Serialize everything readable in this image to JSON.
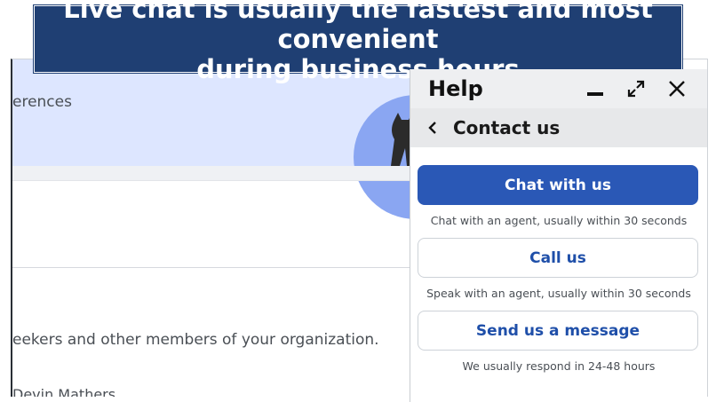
{
  "banner": {
    "line1": "Live chat is usually the fastest and most convenient",
    "line2": "during business hours"
  },
  "background_page": {
    "fragment_1": "erences",
    "fragment_2": "eekers and other members of your organization.",
    "fragment_3": "Devin Mathers"
  },
  "help_panel": {
    "title": "Help",
    "subtitle": "Contact us",
    "options": [
      {
        "label": "Chat with us",
        "description": "Chat with an agent, usually within 30 seconds"
      },
      {
        "label": "Call us",
        "description": "Speak with an agent, usually within 30 seconds"
      },
      {
        "label": "Send us a message",
        "description": "We usually respond in 24-48 hours"
      }
    ]
  },
  "colors": {
    "banner": "#1f3f73",
    "primary_button": "#2a58b6",
    "link_text": "#1f4fa9",
    "hero_bg": "#dde6ff"
  },
  "icons": [
    "minimize-icon",
    "expand-icon",
    "close-icon",
    "chevron-left-icon"
  ]
}
